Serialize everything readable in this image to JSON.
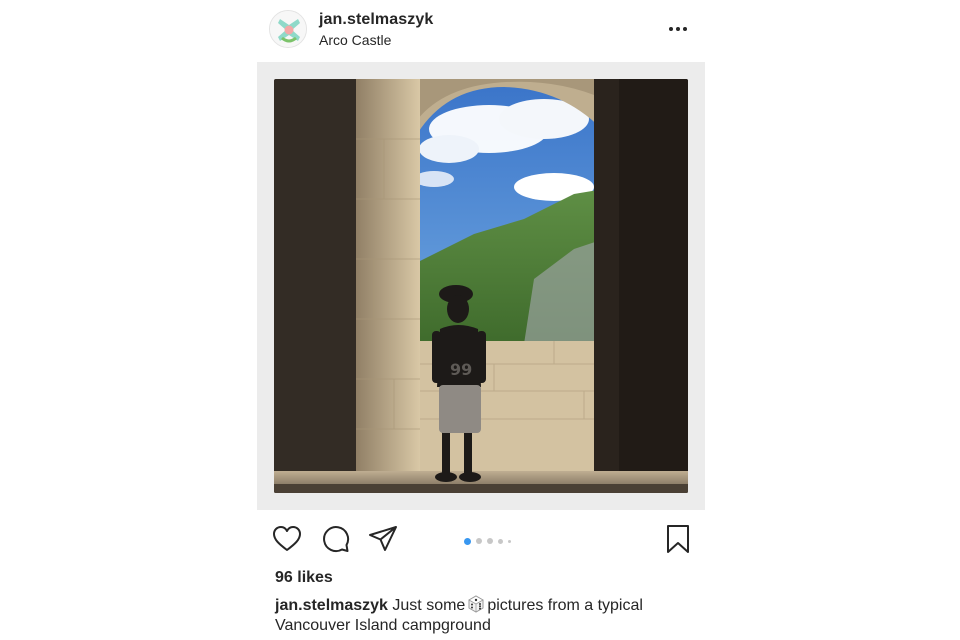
{
  "post": {
    "username": "jan.stelmaszyk",
    "location": "Arco Castle",
    "more_icon": "more-horizontal-icon",
    "photo": {
      "alt_subject": "child silhouette in castle archway overlooking mountains",
      "colors": {
        "sky": "#3f7fd0",
        "stone": "#c9b99a",
        "shadow": "#2a241f",
        "mountain": "#5a8a3a"
      }
    },
    "carousel": {
      "total": 5,
      "active_index": 0
    },
    "actions": {
      "like_icon": "heart-icon",
      "comment_icon": "comment-icon",
      "share_icon": "paper-plane-icon",
      "save_icon": "bookmark-icon"
    },
    "likes": "96 likes",
    "caption": {
      "user": "jan.stelmaszyk",
      "text_before": "Just some",
      "emoji": "game-die-icon",
      "text_after": "pictures from a typical Vancouver Island campground"
    },
    "colors": {
      "text": "#262626",
      "accent": "#3897f0",
      "dot_inactive": "#c7c7c7"
    }
  }
}
